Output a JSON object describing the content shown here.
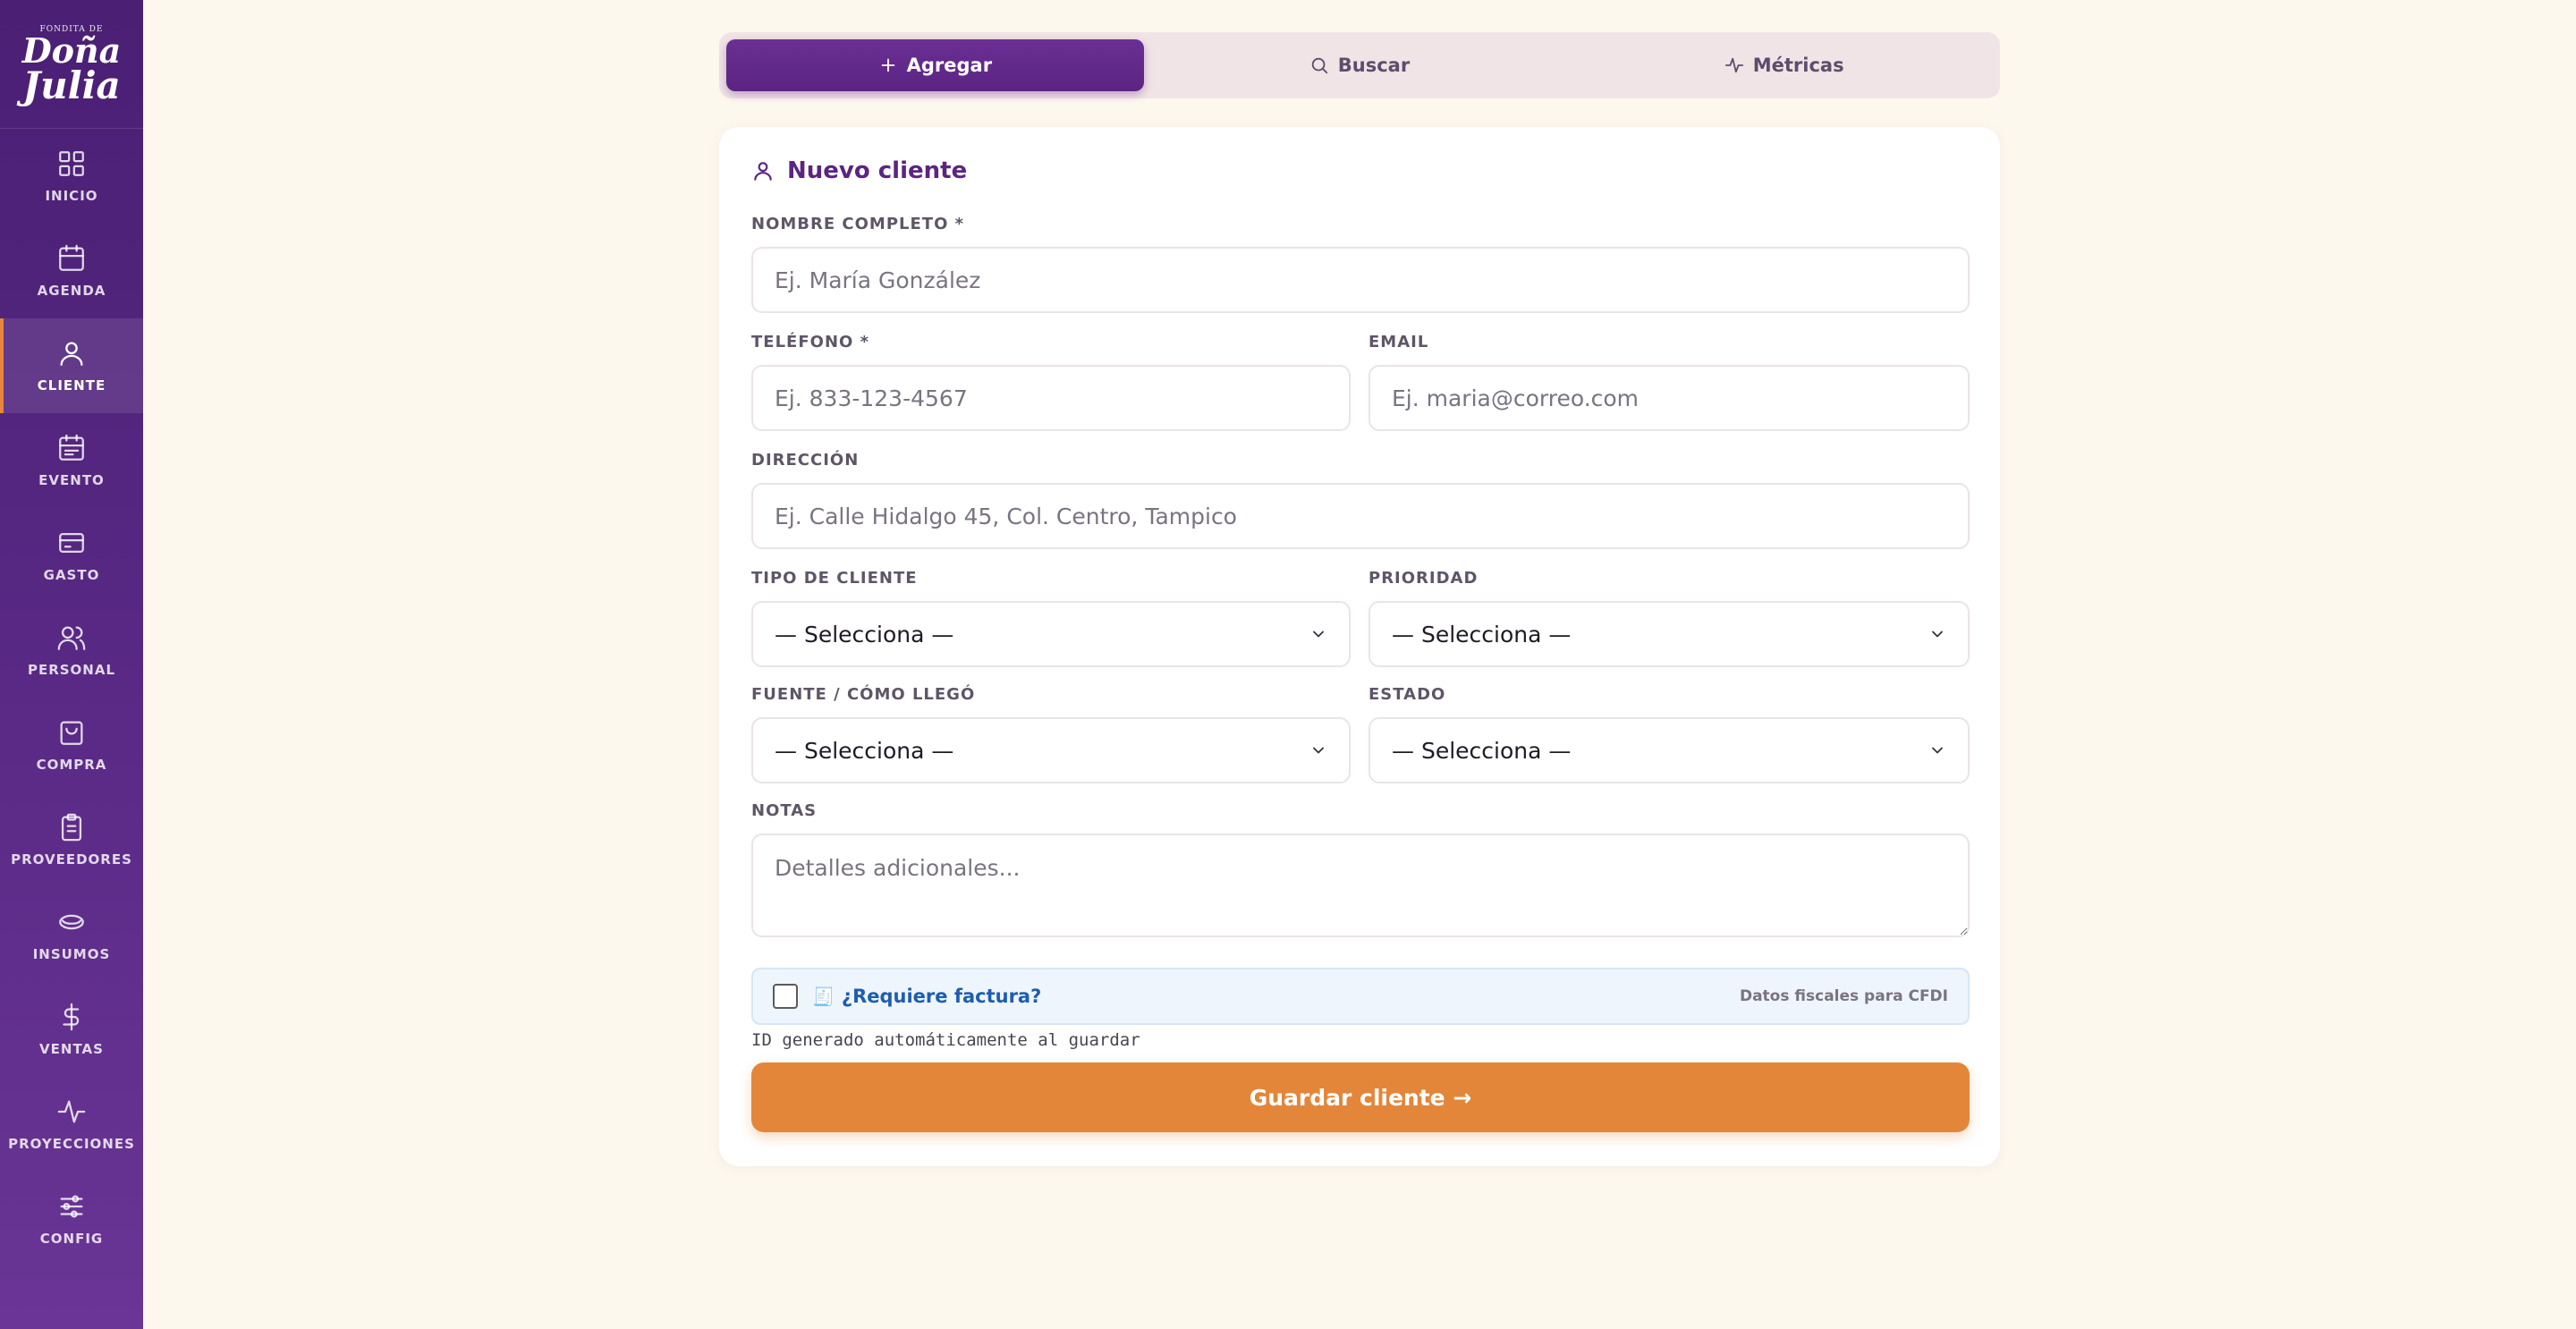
{
  "brand": {
    "small": "FONDITA DE",
    "line1": "Doña",
    "line2": "Julia"
  },
  "sidebar": {
    "items": [
      {
        "label": "INICIO",
        "icon": "grid-icon"
      },
      {
        "label": "AGENDA",
        "icon": "calendar-icon"
      },
      {
        "label": "CLIENTE",
        "icon": "user-icon",
        "active": true
      },
      {
        "label": "EVENTO",
        "icon": "calendar-event-icon"
      },
      {
        "label": "GASTO",
        "icon": "wallet-icon"
      },
      {
        "label": "PERSONAL",
        "icon": "users-icon"
      },
      {
        "label": "COMPRA",
        "icon": "shopping-bag-icon"
      },
      {
        "label": "PROVEEDORES",
        "icon": "clipboard-icon"
      },
      {
        "label": "INSUMOS",
        "icon": "bowl-icon"
      },
      {
        "label": "VENTAS",
        "icon": "dollar-icon"
      },
      {
        "label": "PROYECCIONES",
        "icon": "activity-icon"
      },
      {
        "label": "CONFIG",
        "icon": "sliders-icon"
      }
    ]
  },
  "tabs": [
    {
      "label": "Agregar",
      "icon": "plus-icon",
      "active": true
    },
    {
      "label": "Buscar",
      "icon": "search-icon"
    },
    {
      "label": "Métricas",
      "icon": "activity-icon"
    }
  ],
  "form": {
    "title": "Nuevo cliente",
    "nombre": {
      "label": "NOMBRE COMPLETO *",
      "placeholder": "Ej. María González",
      "value": ""
    },
    "telefono": {
      "label": "TELÉFONO *",
      "placeholder": "Ej. 833-123-4567",
      "value": ""
    },
    "email": {
      "label": "EMAIL",
      "placeholder": "Ej. maria@correo.com",
      "value": ""
    },
    "direccion": {
      "label": "DIRECCIÓN",
      "placeholder": "Ej. Calle Hidalgo 45, Col. Centro, Tampico",
      "value": ""
    },
    "tipo": {
      "label": "TIPO DE CLIENTE",
      "value": "— Selecciona —"
    },
    "prioridad": {
      "label": "PRIORIDAD",
      "value": "— Selecciona —"
    },
    "fuente": {
      "label": "FUENTE / CÓMO LLEGÓ",
      "value": "— Selecciona —"
    },
    "estado": {
      "label": "ESTADO",
      "value": "— Selecciona —"
    },
    "notas": {
      "label": "NOTAS",
      "placeholder": "Detalles adicionales...",
      "value": ""
    },
    "factura": {
      "label": "¿Requiere factura?",
      "note": "Datos fiscales para CFDI",
      "checked": false,
      "emoji": "🧾"
    },
    "id_note": "ID generado automáticamente al guardar",
    "save_label": "Guardar cliente →"
  },
  "colors": {
    "accent": "#5b2482",
    "cta": "#e3863a",
    "background": "#fdf8ee",
    "link": "#1e5db0"
  }
}
